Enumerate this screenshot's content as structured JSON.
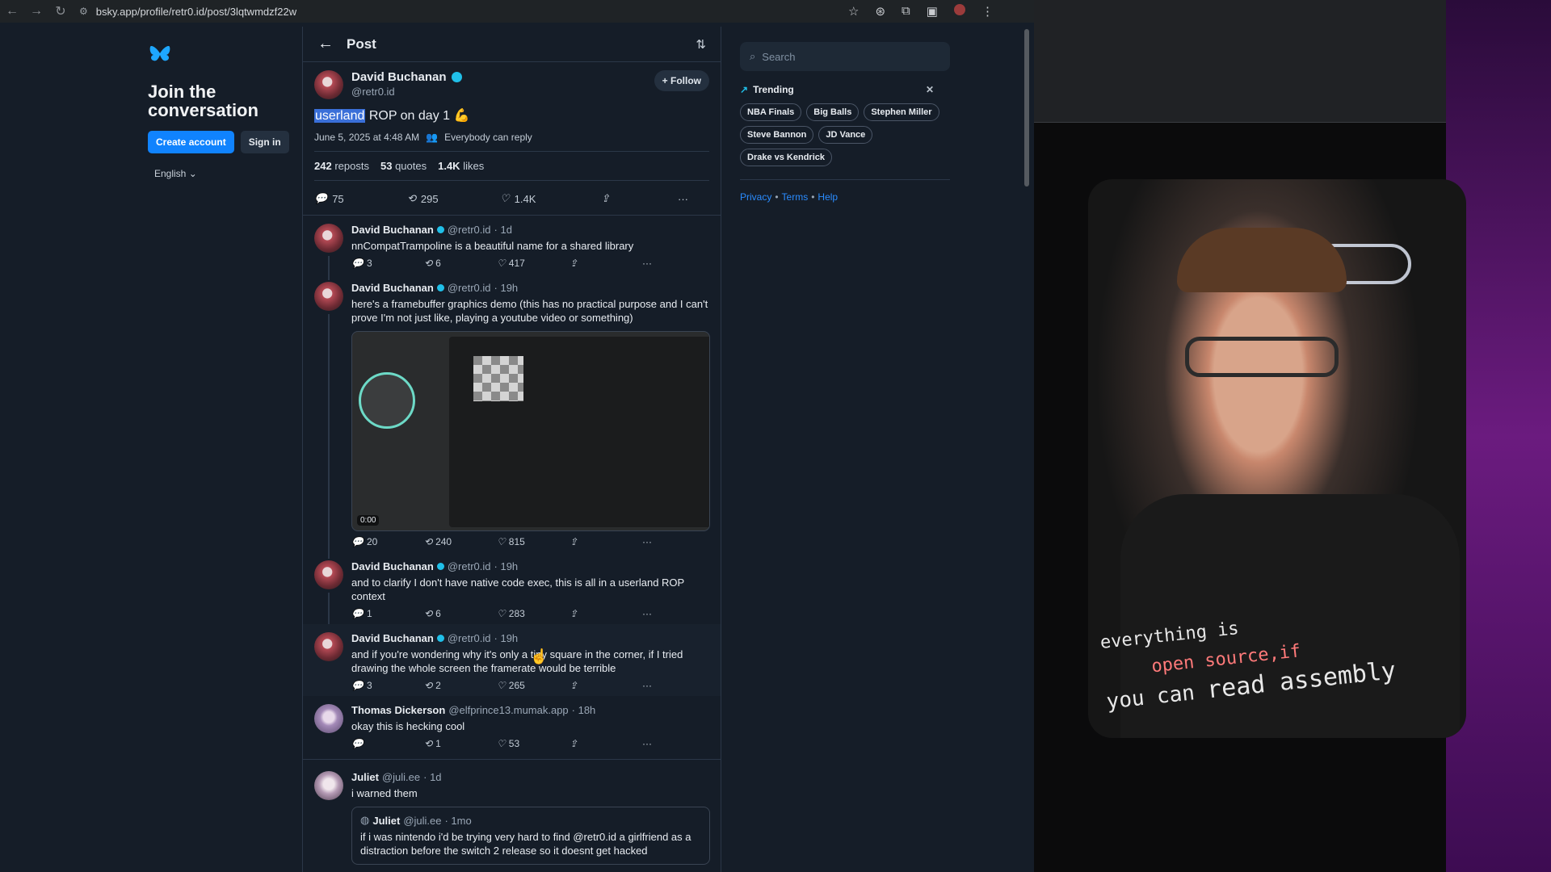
{
  "browser": {
    "url": "bsky.app/profile/retr0.id/post/3lqtwmdzf22w"
  },
  "left": {
    "join_title": "Join the conversation",
    "create_account": "Create account",
    "sign_in": "Sign in",
    "language": "English"
  },
  "feed": {
    "header_title": "Post",
    "main_post": {
      "author": "David Buchanan",
      "handle": "@retr0.id",
      "follow_label": "Follow",
      "text_highlight": "userland",
      "text_rest": " ROP on day 1 💪",
      "date": "June 5, 2025 at 4:48 AM",
      "reply_setting": "Everybody can reply",
      "reposts_count": "242",
      "reposts_label": "reposts",
      "quotes_count": "53",
      "quotes_label": "quotes",
      "likes_count": "1.4K",
      "likes_label": "likes",
      "replies": "75",
      "reposts": "295",
      "likes": "1.4K"
    },
    "replies": [
      {
        "author": "David Buchanan",
        "handle": "@retr0.id",
        "time": "· 1d",
        "text": "nnCompatTrampoline is a beautiful name for a shared library",
        "replies": "3",
        "reposts": "6",
        "likes": "417"
      },
      {
        "author": "David Buchanan",
        "handle": "@retr0.id",
        "time": "· 19h",
        "text": "here's a framebuffer graphics demo (this has no practical purpose and I can't prove I'm not just like, playing a youtube video or something)",
        "video_time": "0:00",
        "replies": "20",
        "reposts": "240",
        "likes": "815"
      },
      {
        "author": "David Buchanan",
        "handle": "@retr0.id",
        "time": "· 19h",
        "text": "and to clarify I don't have native code exec, this is all in a userland ROP context",
        "replies": "1",
        "reposts": "6",
        "likes": "283"
      },
      {
        "author": "David Buchanan",
        "handle": "@retr0.id",
        "time": "· 19h",
        "text": "and if you're wondering why it's only a tiny square in the corner, if I tried drawing the whole screen the framerate would be terrible",
        "replies": "3",
        "reposts": "2",
        "likes": "265"
      },
      {
        "author": "Thomas Dickerson",
        "handle": "@elfprince13.mumak.app",
        "time": "· 18h",
        "text": "okay this is hecking cool",
        "replies": "",
        "reposts": "1",
        "likes": "53"
      },
      {
        "author": "Juliet",
        "handle": "@juli.ee",
        "time": "· 1d",
        "text": "i warned them",
        "quote_author": "Juliet",
        "quote_handle": "@juli.ee",
        "quote_time": "· 1mo",
        "quote_text": "if i was nintendo i'd be trying very hard to find @retr0.id a girlfriend as a distraction before the switch 2 release so it doesnt get hacked"
      }
    ]
  },
  "right": {
    "search_placeholder": "Search",
    "trending_label": "Trending",
    "chips": [
      "NBA Finals",
      "Big Balls",
      "Stephen Miller",
      "Steve Bannon",
      "JD Vance",
      "Drake vs Kendrick"
    ],
    "privacy": "Privacy",
    "terms": "Terms",
    "help": "Help",
    "dot": "•"
  },
  "video_overlay": {
    "caption_line1": "everything is",
    "caption_line2": "open source,if",
    "caption_line3a": "you can ",
    "caption_line3b": "read assembly"
  },
  "colors": {
    "bg": "#151d28",
    "accent": "#1083fe",
    "verified": "#20bfe8",
    "link": "#2a8cff"
  }
}
